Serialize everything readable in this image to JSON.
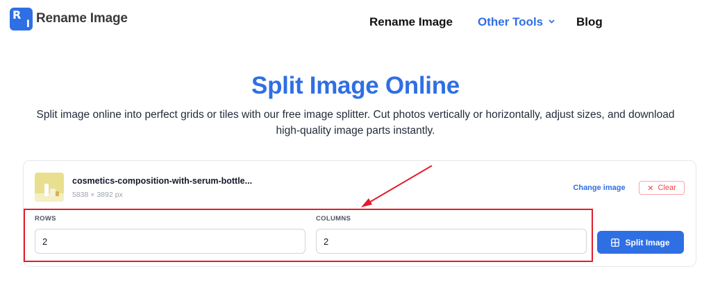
{
  "header": {
    "logo_text": "Rename Image",
    "logo_badge": {
      "letter_top": "R",
      "letter_bottom": "I"
    },
    "nav": {
      "rename_image": "Rename Image",
      "other_tools": "Other Tools",
      "blog": "Blog"
    }
  },
  "hero": {
    "title": "Split Image Online",
    "subtitle": "Split image online into perfect grids or tiles with our free image splitter. Cut photos vertically or horizontally, adjust sizes, and download high-quality image parts instantly."
  },
  "tool": {
    "file_name": "cosmetics-composition-with-serum-bottle...",
    "file_dims": "5838 × 3892 px",
    "change_image_label": "Change image",
    "clear_label": "Clear",
    "rows_label": "ROWS",
    "rows_value": "2",
    "columns_label": "COLUMNS",
    "columns_value": "2",
    "split_button_label": "Split Image"
  },
  "icons": {
    "chevron": "chevron-down-icon",
    "clear": "close-icon",
    "split": "grid-icon"
  },
  "colors": {
    "brand_blue": "#2f6fe4",
    "clear_red": "#ef4444",
    "annotation_red": "#e11d2b"
  }
}
